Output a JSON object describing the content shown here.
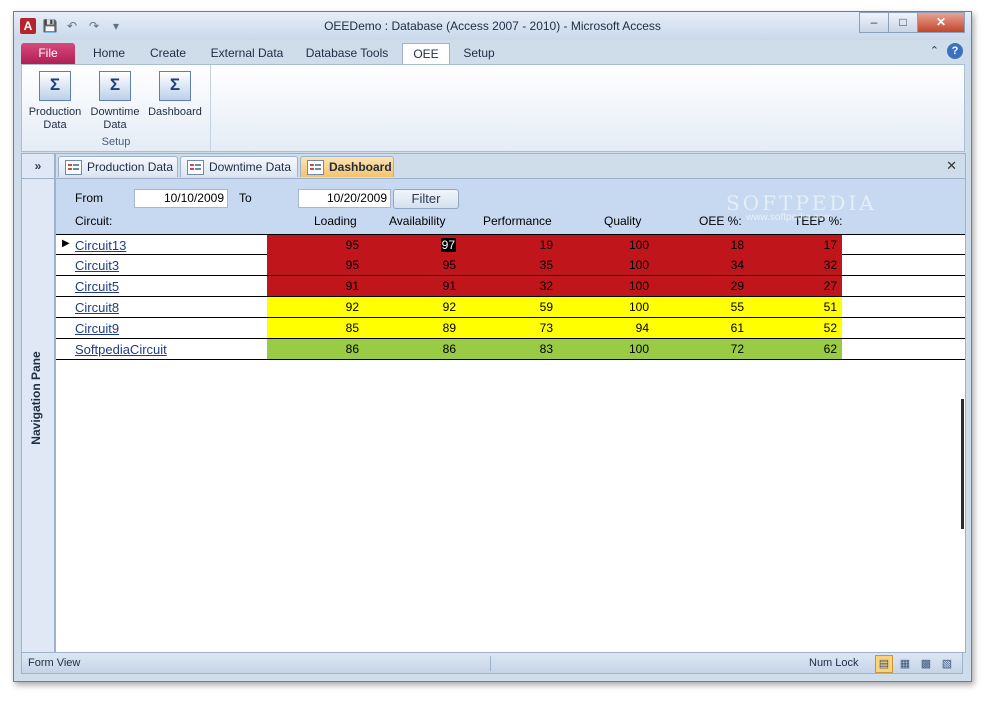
{
  "window": {
    "title": "OEEDemo : Database (Access 2007 - 2010)  -  Microsoft Access",
    "app_icon": "A"
  },
  "qat": [
    "save-icon",
    "undo-icon",
    "redo-icon",
    "customize-icon"
  ],
  "ribbon_tabs": [
    {
      "label": "File"
    },
    {
      "label": "Home"
    },
    {
      "label": "Create"
    },
    {
      "label": "External Data"
    },
    {
      "label": "Database Tools"
    },
    {
      "label": "OEE"
    },
    {
      "label": "Setup"
    }
  ],
  "active_tab": "OEE",
  "ribbon": {
    "buttons": [
      {
        "label": "Production\nData",
        "icon": "Σ"
      },
      {
        "label": "Downtime\nData",
        "icon": "Σ"
      },
      {
        "label": "Dashboard",
        "icon": "Σ"
      }
    ],
    "group_label": "Setup"
  },
  "nav": {
    "toggle": "»",
    "label": "Navigation Pane"
  },
  "doc_tabs": [
    {
      "label": "Production Data"
    },
    {
      "label": "Downtime Data"
    },
    {
      "label": "Dashboard"
    }
  ],
  "form": {
    "from_label": "From",
    "from_value": "10/10/2009",
    "to_label": "To",
    "to_value": "10/20/2009",
    "filter_label": "Filter",
    "circuit_label": "Circuit:",
    "columns": [
      "Loading",
      "Availability",
      "Performance",
      "Quality",
      "OEE %:",
      "TEEP %:"
    ]
  },
  "rows": [
    {
      "circuit": "Circuit13",
      "values": [
        95,
        97,
        19,
        100,
        18,
        17
      ],
      "color": "#c0161b"
    },
    {
      "circuit": "Circuit3",
      "values": [
        95,
        95,
        35,
        100,
        34,
        32
      ],
      "color": "#c0161b"
    },
    {
      "circuit": "Circuit5",
      "values": [
        91,
        91,
        32,
        100,
        29,
        27
      ],
      "color": "#c0161b"
    },
    {
      "circuit": "Circuit8",
      "values": [
        92,
        92,
        59,
        100,
        55,
        51
      ],
      "color": "#ffff00"
    },
    {
      "circuit": "Circuit9",
      "values": [
        85,
        89,
        73,
        94,
        61,
        52
      ],
      "color": "#ffff00"
    },
    {
      "circuit": "SoftpediaCircuit",
      "values": [
        86,
        86,
        83,
        100,
        72,
        62
      ],
      "color": "#99cc44"
    }
  ],
  "watermark": {
    "text": "SOFTPEDIA",
    "url": "www.softpedia.com"
  },
  "status": {
    "left": "Form View",
    "num_lock": "Num Lock"
  }
}
